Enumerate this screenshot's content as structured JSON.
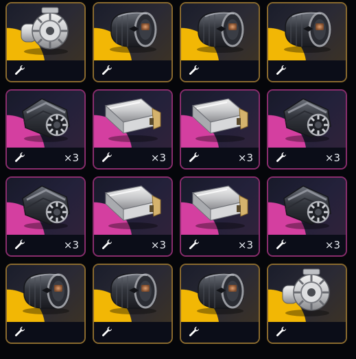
{
  "inventory": {
    "rarity_colors": {
      "gold": "#f2b705",
      "magenta": "#d43fa0"
    },
    "rows": [
      [
        {
          "rarity": "gold",
          "item_icon": "turbo-engine",
          "quantity": ""
        },
        {
          "rarity": "gold",
          "item_icon": "round-tank",
          "quantity": ""
        },
        {
          "rarity": "gold",
          "item_icon": "round-tank",
          "quantity": ""
        },
        {
          "rarity": "gold",
          "item_icon": "round-tank",
          "quantity": ""
        }
      ],
      [
        {
          "rarity": "magenta",
          "item_icon": "gear-canister",
          "quantity": "×3"
        },
        {
          "rarity": "magenta",
          "item_icon": "metal-bar",
          "quantity": "×3"
        },
        {
          "rarity": "magenta",
          "item_icon": "metal-bar",
          "quantity": "×3"
        },
        {
          "rarity": "magenta",
          "item_icon": "gear-canister",
          "quantity": "×3"
        }
      ],
      [
        {
          "rarity": "magenta",
          "item_icon": "gear-canister",
          "quantity": "×3"
        },
        {
          "rarity": "magenta",
          "item_icon": "metal-bar",
          "quantity": "×3"
        },
        {
          "rarity": "magenta",
          "item_icon": "metal-bar",
          "quantity": "×3"
        },
        {
          "rarity": "magenta",
          "item_icon": "gear-canister",
          "quantity": "×3"
        }
      ],
      [
        {
          "rarity": "gold",
          "item_icon": "round-tank",
          "quantity": ""
        },
        {
          "rarity": "gold",
          "item_icon": "round-tank",
          "quantity": ""
        },
        {
          "rarity": "gold",
          "item_icon": "round-tank",
          "quantity": ""
        },
        {
          "rarity": "gold",
          "item_icon": "turbo-engine",
          "quantity": ""
        }
      ]
    ]
  }
}
